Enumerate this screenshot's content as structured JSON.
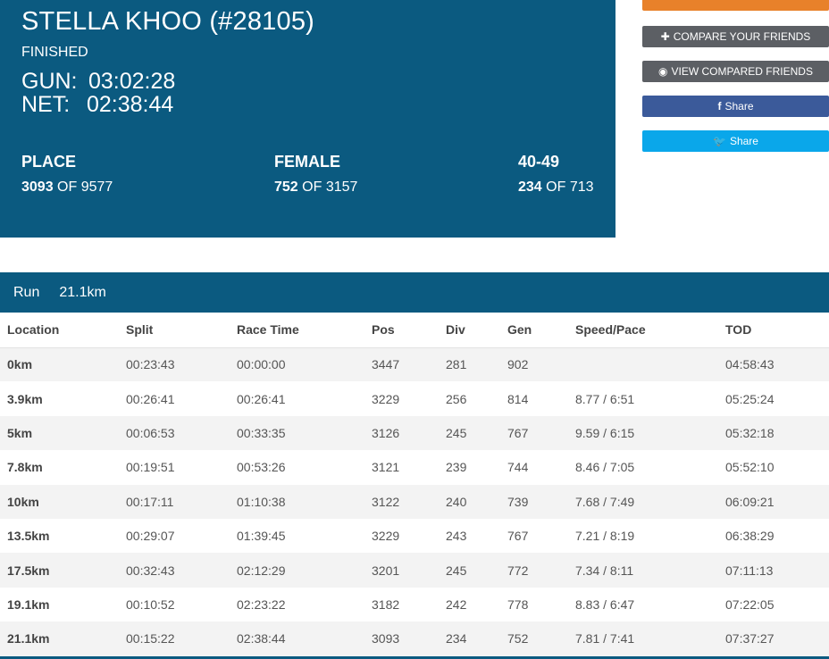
{
  "athlete": {
    "name": "STELLA KHOO (#28105)",
    "status": "FINISHED",
    "gun_label": "GUN:",
    "gun_time": "03:02:28",
    "net_label": "NET:",
    "net_time": "02:38:44"
  },
  "stats": {
    "place": {
      "header": "PLACE",
      "rank": "3093",
      "of_text": "OF 9577"
    },
    "gender": {
      "header": "FEMALE",
      "rank": "752",
      "of_text": "OF 3157"
    },
    "division": {
      "header": "40-49",
      "rank": "234",
      "of_text": "OF 713"
    }
  },
  "actions": {
    "compare_label": "COMPARE YOUR FRIENDS",
    "view_label": "VIEW COMPARED FRIENDS",
    "facebook_label": "Share",
    "twitter_label": "Share"
  },
  "colors": {
    "primary": "#0b5a80",
    "orange": "#e8812a",
    "facebook": "#3b5a9a",
    "twitter": "#0aa7ea",
    "gray_button": "#5c5f64"
  },
  "section": {
    "title": "Run",
    "distance": "21.1km"
  },
  "table": {
    "headers": [
      "Location",
      "Split",
      "Race Time",
      "Pos",
      "Div",
      "Gen",
      "Speed/Pace",
      "TOD"
    ],
    "rows": [
      [
        "0km",
        "00:23:43",
        "00:00:00",
        "3447",
        "281",
        "902",
        "",
        "04:58:43"
      ],
      [
        "3.9km",
        "00:26:41",
        "00:26:41",
        "3229",
        "256",
        "814",
        "8.77 / 6:51",
        "05:25:24"
      ],
      [
        "5km",
        "00:06:53",
        "00:33:35",
        "3126",
        "245",
        "767",
        "9.59 / 6:15",
        "05:32:18"
      ],
      [
        "7.8km",
        "00:19:51",
        "00:53:26",
        "3121",
        "239",
        "744",
        "8.46 / 7:05",
        "05:52:10"
      ],
      [
        "10km",
        "00:17:11",
        "01:10:38",
        "3122",
        "240",
        "739",
        "7.68 / 7:49",
        "06:09:21"
      ],
      [
        "13.5km",
        "00:29:07",
        "01:39:45",
        "3229",
        "243",
        "767",
        "7.21 / 8:19",
        "06:38:29"
      ],
      [
        "17.5km",
        "00:32:43",
        "02:12:29",
        "3201",
        "245",
        "772",
        "7.34 / 8:11",
        "07:11:13"
      ],
      [
        "19.1km",
        "00:10:52",
        "02:23:22",
        "3182",
        "242",
        "778",
        "8.83 / 6:47",
        "07:22:05"
      ],
      [
        "21.1km",
        "00:15:22",
        "02:38:44",
        "3093",
        "234",
        "752",
        "7.81 / 7:41",
        "07:37:27"
      ]
    ]
  }
}
